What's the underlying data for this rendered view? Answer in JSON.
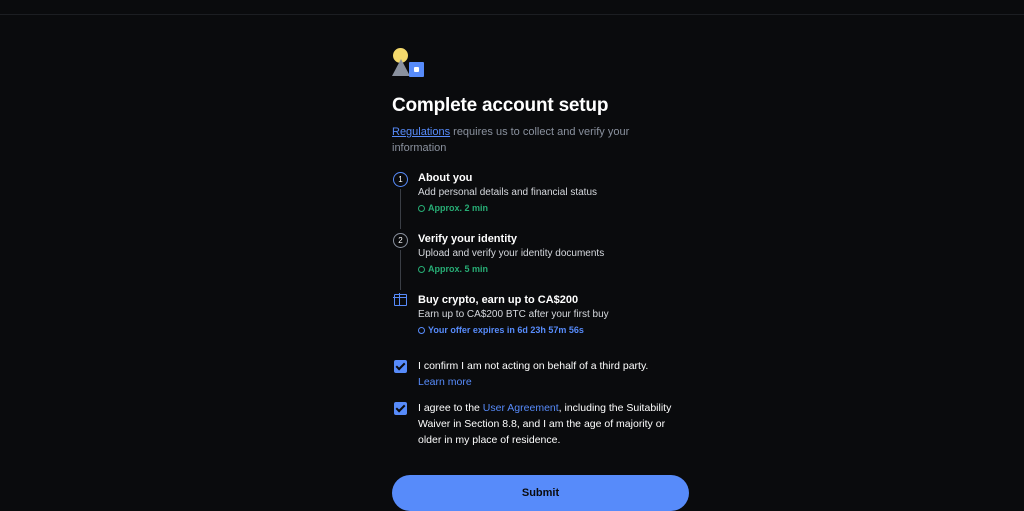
{
  "page": {
    "title": "Complete account setup",
    "intro_link": "Regulations",
    "intro_text": " requires us to collect and verify your information"
  },
  "steps": [
    {
      "number": "1",
      "title": "About you",
      "description": "Add personal details and financial status",
      "meta": "Approx. 2 min"
    },
    {
      "number": "2",
      "title": "Verify your identity",
      "description": "Upload and verify your identity documents",
      "meta": "Approx. 5 min"
    }
  ],
  "offer": {
    "title": "Buy crypto, earn up to CA$200",
    "description": "Earn up to CA$200 BTC after your first buy",
    "countdown": "Your offer expires in 6d 23h 57m 56s"
  },
  "confirmations": {
    "third_party": {
      "text": "I confirm I am not acting on behalf of a third party.",
      "link": "Learn more",
      "checked": true
    },
    "agreement": {
      "prefix": "I agree to the ",
      "link": "User Agreement",
      "suffix": ", including the Suitability Waiver in Section 8.8, and I am the age of majority or older in my place of residence.",
      "checked": true
    }
  },
  "submit_label": "Submit",
  "colors": {
    "background": "#0a0b0d",
    "accent": "#578bfa",
    "success": "#27ad75",
    "muted": "#8a919e"
  },
  "icons": [
    "shapes-logo-icon",
    "step-number-icon",
    "clock-icon",
    "gift-icon",
    "checkbox-checked-icon"
  ]
}
